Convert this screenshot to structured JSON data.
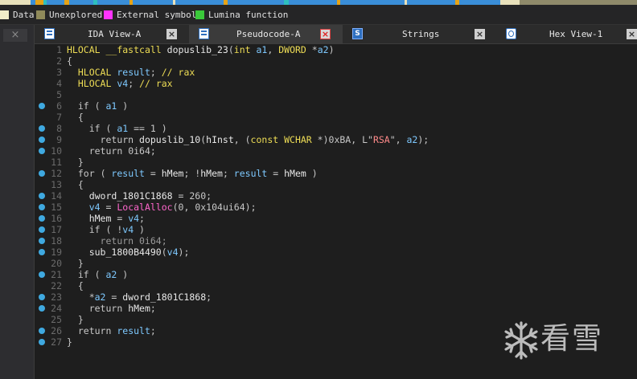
{
  "nav_colors": {
    "data": "#e8e1bb",
    "unexplored": "#8f8a6a",
    "external": "#ff00ff",
    "lumina": "#3fcf3f",
    "code": "#3a8ed8",
    "func": "#e6a317",
    "library": "#2ebfbf"
  },
  "legend": [
    {
      "label": "Data",
      "color": "#f2eec8"
    },
    {
      "label": "Unexplored",
      "color": "#8f8a5a"
    },
    {
      "label": "External symbol",
      "color": "#ff33ff"
    },
    {
      "label": "Lumina function",
      "color": "#3ac83a"
    }
  ],
  "left_panel": {
    "close_glyph": "×"
  },
  "tabs": [
    {
      "label": "IDA View-A",
      "icon": "doc-icon",
      "close_glyph": "×",
      "active": false
    },
    {
      "label": "Pseudocode-A",
      "icon": "doc-icon",
      "close_glyph": "×",
      "active": true
    },
    {
      "label": "Strings",
      "icon": "strings-icon",
      "icon_glyph": "S",
      "close_glyph": "×",
      "active": false
    },
    {
      "label": "Hex View-1",
      "icon": "hex-icon",
      "close_glyph": "×",
      "active": false
    }
  ],
  "code_lines": [
    {
      "num": "1",
      "dot": false,
      "tokens": [
        [
          "type",
          "HLOCAL"
        ],
        [
          "pn",
          " "
        ],
        [
          "type",
          "__fastcall"
        ],
        [
          "pn",
          " "
        ],
        [
          "fn",
          "dopuslib_23"
        ],
        [
          "pn",
          "("
        ],
        [
          "type",
          "int"
        ],
        [
          "pn",
          " "
        ],
        [
          "var",
          "a1"
        ],
        [
          "pn",
          ", "
        ],
        [
          "type",
          "DWORD"
        ],
        [
          "pn",
          " *"
        ],
        [
          "var",
          "a2"
        ],
        [
          "pn",
          ")"
        ]
      ]
    },
    {
      "num": "2",
      "dot": false,
      "tokens": [
        [
          "pn",
          "{"
        ]
      ]
    },
    {
      "num": "3",
      "dot": false,
      "tokens": [
        [
          "pn",
          "  "
        ],
        [
          "type",
          "HLOCAL"
        ],
        [
          "pn",
          " "
        ],
        [
          "var",
          "result"
        ],
        [
          "pn",
          "; "
        ],
        [
          "cm",
          "// rax"
        ]
      ]
    },
    {
      "num": "4",
      "dot": false,
      "tokens": [
        [
          "pn",
          "  "
        ],
        [
          "type",
          "HLOCAL"
        ],
        [
          "pn",
          " "
        ],
        [
          "var",
          "v4"
        ],
        [
          "pn",
          "; "
        ],
        [
          "cm",
          "// rax"
        ]
      ]
    },
    {
      "num": "5",
      "dot": false,
      "tokens": []
    },
    {
      "num": "6",
      "dot": true,
      "tokens": [
        [
          "pn",
          "  "
        ],
        [
          "kw",
          "if"
        ],
        [
          "pn",
          " ( "
        ],
        [
          "var",
          "a1"
        ],
        [
          "pn",
          " )"
        ]
      ]
    },
    {
      "num": "7",
      "dot": false,
      "tokens": [
        [
          "pn",
          "  {"
        ]
      ]
    },
    {
      "num": "8",
      "dot": true,
      "tokens": [
        [
          "pn",
          "    "
        ],
        [
          "kw",
          "if"
        ],
        [
          "pn",
          " ( "
        ],
        [
          "var",
          "a1"
        ],
        [
          "pn",
          " == "
        ],
        [
          "num",
          "1"
        ],
        [
          "pn",
          " )"
        ]
      ]
    },
    {
      "num": "9",
      "dot": true,
      "tokens": [
        [
          "pn",
          "      "
        ],
        [
          "kw",
          "return"
        ],
        [
          "pn",
          " "
        ],
        [
          "fn",
          "dopuslib_10"
        ],
        [
          "pn",
          "("
        ],
        [
          "gl",
          "hInst"
        ],
        [
          "pn",
          ", ("
        ],
        [
          "type",
          "const"
        ],
        [
          "pn",
          " "
        ],
        [
          "type",
          "WCHAR"
        ],
        [
          "pn",
          " *)"
        ],
        [
          "num",
          "0xBA"
        ],
        [
          "pn",
          ", "
        ],
        [
          "pn",
          "L\""
        ],
        [
          "str",
          "RSA"
        ],
        [
          "pn",
          "\", "
        ],
        [
          "var",
          "a2"
        ],
        [
          "pn",
          ");"
        ]
      ]
    },
    {
      "num": "10",
      "dot": true,
      "tokens": [
        [
          "pn",
          "    "
        ],
        [
          "kw",
          "return"
        ],
        [
          "pn",
          " "
        ],
        [
          "num",
          "0i64"
        ],
        [
          "pn",
          ";"
        ]
      ]
    },
    {
      "num": "11",
      "dot": false,
      "tokens": [
        [
          "pn",
          "  }"
        ]
      ]
    },
    {
      "num": "12",
      "dot": true,
      "tokens": [
        [
          "pn",
          "  "
        ],
        [
          "kw",
          "for"
        ],
        [
          "pn",
          " ( "
        ],
        [
          "var",
          "result"
        ],
        [
          "pn",
          " = "
        ],
        [
          "gl",
          "hMem"
        ],
        [
          "pn",
          "; !"
        ],
        [
          "gl",
          "hMem"
        ],
        [
          "pn",
          "; "
        ],
        [
          "var",
          "result"
        ],
        [
          "pn",
          " = "
        ],
        [
          "gl",
          "hMem"
        ],
        [
          "pn",
          " )"
        ]
      ]
    },
    {
      "num": "13",
      "dot": false,
      "tokens": [
        [
          "pn",
          "  {"
        ]
      ]
    },
    {
      "num": "14",
      "dot": true,
      "tokens": [
        [
          "pn",
          "    "
        ],
        [
          "gl",
          "dword_1801C1868"
        ],
        [
          "pn",
          " = "
        ],
        [
          "num",
          "260"
        ],
        [
          "pn",
          ";"
        ]
      ]
    },
    {
      "num": "15",
      "dot": true,
      "tokens": [
        [
          "pn",
          "    "
        ],
        [
          "var",
          "v4"
        ],
        [
          "pn",
          " = "
        ],
        [
          "api",
          "LocalAlloc"
        ],
        [
          "pn",
          "("
        ],
        [
          "num",
          "0"
        ],
        [
          "pn",
          ", "
        ],
        [
          "num",
          "0x104ui64"
        ],
        [
          "pn",
          ");"
        ]
      ]
    },
    {
      "num": "16",
      "dot": true,
      "tokens": [
        [
          "pn",
          "    "
        ],
        [
          "gl",
          "hMem"
        ],
        [
          "pn",
          " = "
        ],
        [
          "var",
          "v4"
        ],
        [
          "pn",
          ";"
        ]
      ]
    },
    {
      "num": "17",
      "dot": true,
      "tokens": [
        [
          "pn",
          "    "
        ],
        [
          "kw",
          "if"
        ],
        [
          "pn",
          " ( !"
        ],
        [
          "var",
          "v4"
        ],
        [
          "pn",
          " )"
        ]
      ]
    },
    {
      "num": "18",
      "dot": true,
      "tokens": [
        [
          "pn",
          "      "
        ],
        [
          "dim",
          "return 0i64;"
        ]
      ]
    },
    {
      "num": "19",
      "dot": true,
      "tokens": [
        [
          "pn",
          "    "
        ],
        [
          "fn",
          "sub_1800B4490"
        ],
        [
          "pn",
          "("
        ],
        [
          "var",
          "v4"
        ],
        [
          "pn",
          ");"
        ]
      ]
    },
    {
      "num": "20",
      "dot": false,
      "tokens": [
        [
          "pn",
          "  }"
        ]
      ]
    },
    {
      "num": "21",
      "dot": true,
      "tokens": [
        [
          "pn",
          "  "
        ],
        [
          "kw",
          "if"
        ],
        [
          "pn",
          " ( "
        ],
        [
          "var",
          "a2"
        ],
        [
          "pn",
          " )"
        ]
      ]
    },
    {
      "num": "22",
      "dot": false,
      "tokens": [
        [
          "pn",
          "  {"
        ]
      ]
    },
    {
      "num": "23",
      "dot": true,
      "tokens": [
        [
          "pn",
          "    *"
        ],
        [
          "var",
          "a2"
        ],
        [
          "pn",
          " = "
        ],
        [
          "gl",
          "dword_1801C1868"
        ],
        [
          "pn",
          ";"
        ]
      ]
    },
    {
      "num": "24",
      "dot": true,
      "tokens": [
        [
          "pn",
          "    "
        ],
        [
          "kw",
          "return"
        ],
        [
          "pn",
          " "
        ],
        [
          "gl",
          "hMem"
        ],
        [
          "pn",
          ";"
        ]
      ]
    },
    {
      "num": "25",
      "dot": false,
      "tokens": [
        [
          "pn",
          "  }"
        ]
      ]
    },
    {
      "num": "26",
      "dot": true,
      "tokens": [
        [
          "pn",
          "  "
        ],
        [
          "kw",
          "return"
        ],
        [
          "pn",
          " "
        ],
        [
          "var",
          "result"
        ],
        [
          "pn",
          ";"
        ]
      ]
    },
    {
      "num": "27",
      "dot": true,
      "tokens": [
        [
          "pn",
          "}"
        ]
      ]
    }
  ],
  "watermark": {
    "text": "看雪",
    "icon": "snowflake-logo-icon"
  }
}
